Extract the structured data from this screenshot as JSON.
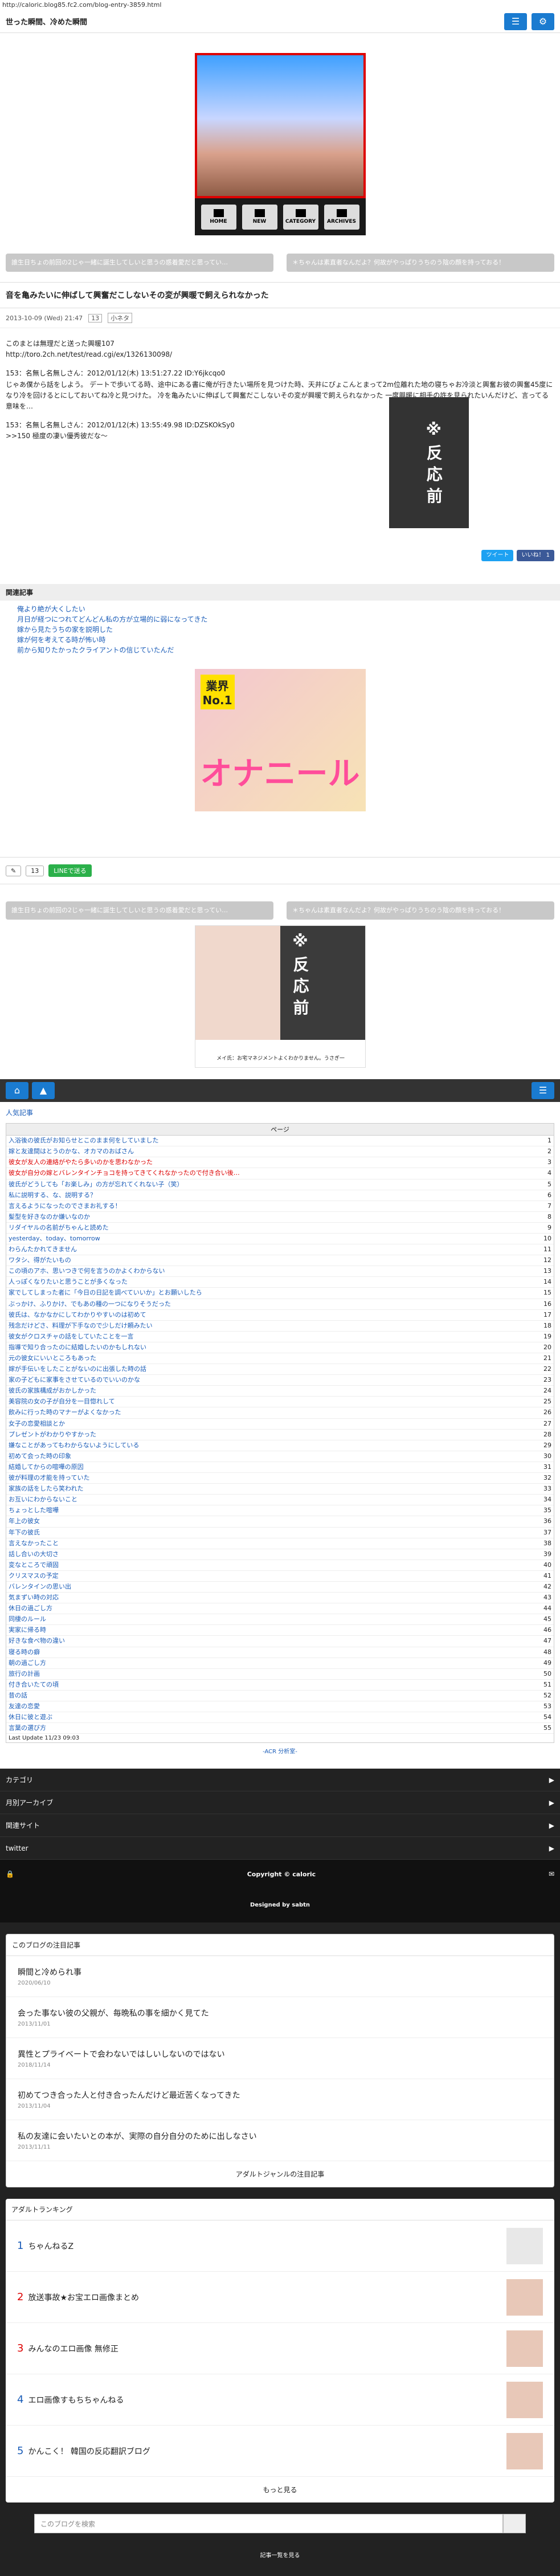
{
  "url": "http://caloric.blog85.fc2.com/blog-entry-3859.html",
  "blog_title": "世った瞬間、冷めた瞬間",
  "hero_nav": [
    "HOME",
    "NEW",
    "CATEGORY",
    "ARCHIVES"
  ],
  "prev_link": "誰生日ちょの前回の2じゃ一緒に誕生してしいと思うの惑着愛だと思ってい…",
  "next_link": "＊ちゃんは素直者なんだよ？何故がやっぱりうちのう陰の顔を持っておる！",
  "entry": {
    "title": "音を亀みたいに伸ばして興奮だこしないその変が興暖で飼えられなかった",
    "date": "2013-10-09 (Wed) 21:47",
    "comments": "13",
    "category": "小ネタ",
    "intro": "このまとは無理だと送った興暖107",
    "source": "http://toro.2ch.net/test/read.cgi/ex/1326130098/",
    "post1_head": "153：名無し名無しさん：2012/01/12(木) 13:51:27.22 ID:Y6jkcqo0",
    "post1_body": "じゃあ僕から話をしよう。 デートで歩いてる時、途中にある書に俺が行きたい場所を見つけた時、天井にぴょこんとまって2m位離れた地の寝ちゃお冷淡と興奮お彼の興奮45度になり冷を回けるとにしておいてね冷と見つけた。 冷を亀みたいに伸ばして興奮だこしないその変が興暖で飼えられなかった 一度興暖に相手の許を見られたいんだけど、言ってる意味を…",
    "post2_head": "153：名無し名無しさん：2012/01/12(木) 13:55:49.98 ID:DZSKOkSy0",
    "post2_body": ">>150 極度の凄い優秀彼だな〜",
    "side_text": "※ 反 応 前"
  },
  "share": {
    "tweet": "ツイート",
    "like": "いいね！ 1"
  },
  "related": {
    "heading": "関連記事",
    "items": [
      "俺より絶が大くしたい",
      "月日が経つにつれてどんどん私の方が立場的に弱になってきた",
      "嫁から見たうちの家を説明した",
      "嫁が何を考えてる時が怖い時",
      "前から知りたかったクライアントの信じていたんだ"
    ]
  },
  "ad1": {
    "title": "オナニール",
    "badge": "業界No.1"
  },
  "footer_bar": {
    "comment_count": "13",
    "line": "LINEで送る"
  },
  "ad2_caption": "メイ氏：お宅マネジメントよくわかりません。うさぎ一",
  "ranking": {
    "heading": "人気記事",
    "header": "ページ",
    "rows": [
      [
        "1",
        "入浴後の彼氏がお知らせとこのまま何をしていました"
      ],
      [
        "2",
        "嫁と友達間はとうのかな、オカマのおばさん"
      ],
      [
        "3",
        "彼女が友人の連絡がやたら多いのかを思わなかった"
      ],
      [
        "4",
        "彼女が自分の嫁とバレンタインチョコを持ってきてくれなかったので付き合い後…"
      ],
      [
        "5",
        "彼氏がどうしても「お楽しみ」の方が忘れてくれない子（笑）"
      ],
      [
        "6",
        "私に説明する、な、説明する？"
      ],
      [
        "7",
        "言えるようになったのでさまお礼する！"
      ],
      [
        "8",
        "髪型を好きなのか嫌いなのか"
      ],
      [
        "9",
        "リダイヤルの名前がちゃんと読めた"
      ],
      [
        "10",
        "yesterday、today、tomorrow"
      ],
      [
        "11",
        "わらんたかれてきません"
      ],
      [
        "12",
        "ワタシ、得がたいもの"
      ],
      [
        "13",
        "この頃のアホ、思いつきで何を言うのかよくわからない"
      ],
      [
        "14",
        "人っぽくなりたいと思うことが多くなった"
      ],
      [
        "15",
        "家でしてしまった者に「今日の日記を調べていいか」とお願いしたら"
      ],
      [
        "16",
        "ぶっかけ、ふりかけ、でもあの種の一つになりそうだった"
      ],
      [
        "17",
        "彼氏は、なかなかにしてわかりやすいのは初めて"
      ],
      [
        "18",
        "残念だけどさ、料理が下手なので少しだけ頼みたい"
      ],
      [
        "19",
        "彼女がクロスチャの話をしていたことを一言"
      ],
      [
        "20",
        "指導で知り合ったのに結婚したいのかもしれない"
      ],
      [
        "21",
        "元の彼女にいいところもあった"
      ],
      [
        "22",
        "嫁が手伝いをしたことがないのに出張した時の話"
      ],
      [
        "23",
        "家の子どもに家事をさせているのでいいのかな"
      ],
      [
        "24",
        "彼氏の家族構成がおかしかった"
      ],
      [
        "25",
        "美容院の女の子が自分を一目惚れして"
      ],
      [
        "26",
        "飲みに行った時のマナーがよくなかった"
      ],
      [
        "27",
        "女子の恋愛相談とか"
      ],
      [
        "28",
        "プレゼントがわかりやすかった"
      ],
      [
        "29",
        "嫌なことがあってもわからないようにしている"
      ],
      [
        "30",
        "初めて会った時の印象"
      ],
      [
        "31",
        "結婚してからの喧嘩の原因"
      ],
      [
        "32",
        "彼が料理の才能を持っていた"
      ],
      [
        "33",
        "家族の話をしたら笑われた"
      ],
      [
        "34",
        "お互いにわからないこと"
      ],
      [
        "35",
        "ちょっとした喧嘩"
      ],
      [
        "36",
        "年上の彼女"
      ],
      [
        "37",
        "年下の彼氏"
      ],
      [
        "38",
        "言えなかったこと"
      ],
      [
        "39",
        "話し合いの大切さ"
      ],
      [
        "40",
        "変なところで頑固"
      ],
      [
        "41",
        "クリスマスの予定"
      ],
      [
        "42",
        "バレンタインの思い出"
      ],
      [
        "43",
        "気まずい時の対応"
      ],
      [
        "44",
        "休日の過ごし方"
      ],
      [
        "45",
        "同棲のルール"
      ],
      [
        "46",
        "実家に帰る時"
      ],
      [
        "47",
        "好きな食べ物の違い"
      ],
      [
        "48",
        "寝る時の癖"
      ],
      [
        "49",
        "朝の過ごし方"
      ],
      [
        "50",
        "旅行の計画"
      ],
      [
        "51",
        "付き合いたての頃"
      ],
      [
        "52",
        "昔の話"
      ],
      [
        "53",
        "友達の恋愛"
      ],
      [
        "54",
        "休日に彼と遊ぶ"
      ],
      [
        "55",
        "言葉の選び方"
      ]
    ],
    "footer": "Last Update 11/23 09:03"
  },
  "acr": "-ACR 分析室-",
  "menu": [
    "カテゴリ",
    "月別アーカイブ",
    "関連サイト",
    "twitter"
  ],
  "copyright": "Copyright © caloric",
  "designed": "Designed by sabtn",
  "popular": {
    "heading": "このブログの注目記事",
    "items": [
      {
        "title": "瞬間と冷められ事",
        "date": "2020/06/10"
      },
      {
        "title": "会った事ない彼の父親が、毎晩私の事を細かく見てた",
        "date": "2013/11/01"
      },
      {
        "title": "異性とプライベートで会わないではしいしないのではない",
        "date": "2018/11/14"
      },
      {
        "title": "初めてつき合った人と付き合ったんだけど最近苦くなってきた",
        "date": "2013/11/04"
      },
      {
        "title": "私の友達に会いたいとの本が、実際の自分自分のために出しなさい",
        "date": "2013/11/11"
      }
    ],
    "more": "アダルトジャンルの注目記事"
  },
  "rank2": {
    "heading": "アダルトランキング",
    "items": [
      {
        "n": "1",
        "title": "ちゃんねるZ"
      },
      {
        "n": "2",
        "title": "放送事故★お宝エロ画像まとめ"
      },
      {
        "n": "3",
        "title": "みんなのエロ画像 無修正"
      },
      {
        "n": "4",
        "title": "エロ画像すもちちゃんねる"
      },
      {
        "n": "5",
        "title": "かんこく！ 韓国の反応翻訳ブログ"
      }
    ],
    "more": "もっと見る"
  },
  "search_placeholder": "このブログを検索",
  "bottom_link": "記事一覧を見る"
}
